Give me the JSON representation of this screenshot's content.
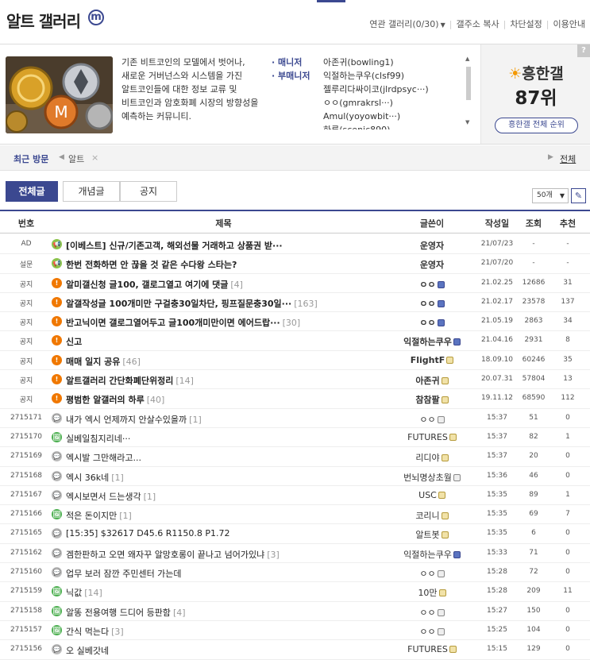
{
  "gallery": {
    "title": "알트 갤러리",
    "badge": "m"
  },
  "header": {
    "related": "연관 갤러리(0/30)",
    "copy_url": "갤주소 복사",
    "block_settings": "차단설정",
    "guide": "이용안내"
  },
  "info": {
    "description": "기존 비트코인의 모델에서 벗어나, 새로운 거버넌스와 시스템을 가진 알트코인들에 대한 정보 교류 및 비트코인과 암호화폐 시장의 방향성을 예측하는 커뮤니티.",
    "manager_label": "· 매니저",
    "manager": "아존귀(bowling1)",
    "submanager_label": "· 부매니저",
    "submanagers": [
      "익절하는쿠우(clsf99)",
      "젤루리다싸이코(jlrdpsyc···)",
      "ㅇㅇ(gmrakrsl···)",
      "Amul(yoyowbit···)",
      "하루(scenic890)"
    ]
  },
  "rank": {
    "q": "?",
    "sun": "☀",
    "name": "흥한갤",
    "number": "87위",
    "button": "흥한갤 전체 순위"
  },
  "recent": {
    "label": "최근 방문",
    "prev": "◀",
    "item": "알트",
    "close": "×",
    "next": "▶",
    "all": "전체"
  },
  "tabs": [
    {
      "label": "전체글"
    },
    {
      "label": "개념글"
    },
    {
      "label": "공지"
    }
  ],
  "page_size": "50개",
  "write_icon": "✎",
  "columns": {
    "no": "번호",
    "title": "제목",
    "writer": "글쓴이",
    "date": "작성일",
    "views": "조회",
    "recommend": "추천"
  },
  "icons": {
    "ad": "📢",
    "notice": "!",
    "chat": "💬",
    "image": "🖼"
  },
  "posts": [
    {
      "no": "AD",
      "icon": "ad",
      "title": "[이베스트] 신규/기존고객, 해외선물 거래하고 상품권 받···",
      "count": "",
      "writer": "운영자",
      "wicon": "",
      "date": "21/07/23",
      "views": "-",
      "rec": "-",
      "bold": true
    },
    {
      "no": "설문",
      "icon": "ad",
      "title": "한번 전화하면 안 끊을 것 같은 수다왕 스타는?",
      "count": "",
      "writer": "운영자",
      "wicon": "",
      "date": "21/07/20",
      "views": "-",
      "rec": "-",
      "bold": true
    },
    {
      "no": "공지",
      "icon": "notice",
      "title": "알미갤신청 글100, 갤로그열고 여기에 댓글",
      "count": "[4]",
      "writer": "ㅇㅇ",
      "wicon": "blue",
      "date": "21.02.25",
      "views": "12686",
      "rec": "31",
      "bold": true
    },
    {
      "no": "공지",
      "icon": "notice",
      "title": "알갤작성글 100개미만 구걸충30일차단, 핑프질문충30일···",
      "count": "[163]",
      "writer": "ㅇㅇ",
      "wicon": "blue",
      "date": "21.02.17",
      "views": "23578",
      "rec": "137",
      "bold": true
    },
    {
      "no": "공지",
      "icon": "notice",
      "title": "반고닉이면 갤로그열어두고 글100개미만이면 에어드랍···",
      "count": "[30]",
      "writer": "ㅇㅇ",
      "wicon": "blue",
      "date": "21.05.19",
      "views": "2863",
      "rec": "34",
      "bold": true
    },
    {
      "no": "공지",
      "icon": "notice",
      "title": "신고",
      "count": "",
      "writer": "익절하는쿠우",
      "wicon": "blue",
      "date": "21.04.16",
      "views": "2931",
      "rec": "8",
      "bold": true
    },
    {
      "no": "공지",
      "icon": "notice",
      "title": "매매 일지 공유",
      "count": "[46]",
      "writer": "FlightF",
      "wicon": "gold",
      "date": "18.09.10",
      "views": "60246",
      "rec": "35",
      "bold": true
    },
    {
      "no": "공지",
      "icon": "notice",
      "title": "알트갤러리 간단화폐단위정리",
      "count": "[14]",
      "writer": "아존귀",
      "wicon": "gold",
      "date": "20.07.31",
      "views": "57804",
      "rec": "13",
      "bold": true
    },
    {
      "no": "공지",
      "icon": "notice",
      "title": "평범한 알갤러의 하루",
      "count": "[40]",
      "writer": "참참팔",
      "wicon": "gold",
      "date": "19.11.12",
      "views": "68590",
      "rec": "112",
      "bold": true
    },
    {
      "no": "2715171",
      "icon": "chat",
      "title": "내가 엑시 언제까지 안살수있을까",
      "count": "[1]",
      "writer": "ㅇㅇ",
      "wicon": "grey",
      "date": "15:37",
      "views": "51",
      "rec": "0",
      "bold": false
    },
    {
      "no": "2715170",
      "icon": "img",
      "title": "실베일침지리네···",
      "count": "",
      "writer": "FUTURES",
      "wicon": "gold",
      "date": "15:37",
      "views": "82",
      "rec": "1",
      "bold": false
    },
    {
      "no": "2715169",
      "icon": "chat",
      "title": "엑시발 그만해라고...",
      "count": "",
      "writer": "리디야",
      "wicon": "gold",
      "date": "15:37",
      "views": "20",
      "rec": "0",
      "bold": false
    },
    {
      "no": "2715168",
      "icon": "chat",
      "title": "엑시 36k네",
      "count": "[1]",
      "writer": "번뇌명상초월",
      "wicon": "grey",
      "date": "15:36",
      "views": "46",
      "rec": "0",
      "bold": false
    },
    {
      "no": "2715167",
      "icon": "chat",
      "title": "엑시보면서 드는생각",
      "count": "[1]",
      "writer": "USC",
      "wicon": "gold",
      "date": "15:35",
      "views": "89",
      "rec": "1",
      "bold": false
    },
    {
      "no": "2715166",
      "icon": "img",
      "title": "적은 돈이지만",
      "count": "[1]",
      "writer": "코리니",
      "wicon": "gold",
      "date": "15:35",
      "views": "69",
      "rec": "7",
      "bold": false
    },
    {
      "no": "2715165",
      "icon": "chat",
      "title": "[15:35] $32617 D45.6 R1150.8 P1.72",
      "count": "",
      "writer": "알트봇",
      "wicon": "gold",
      "date": "15:35",
      "views": "6",
      "rec": "0",
      "bold": false
    },
    {
      "no": "2715162",
      "icon": "chat",
      "title": "겜한판하고 오면 왜자꾸 알망호롱이 끝나고 넘어가있냐",
      "count": "[3]",
      "writer": "익절하는쿠우",
      "wicon": "blue",
      "date": "15:33",
      "views": "71",
      "rec": "0",
      "bold": false
    },
    {
      "no": "2715160",
      "icon": "chat",
      "title": "업무 보러 잠깐 주민센터 가는데",
      "count": "",
      "writer": "ㅇㅇ",
      "wicon": "grey",
      "date": "15:28",
      "views": "72",
      "rec": "0",
      "bold": false
    },
    {
      "no": "2715159",
      "icon": "img",
      "title": "닉값",
      "count": "[14]",
      "writer": "10만",
      "wicon": "gold",
      "date": "15:28",
      "views": "209",
      "rec": "11",
      "bold": false
    },
    {
      "no": "2715158",
      "icon": "img",
      "title": "알똥 전용여행 드디어 등판함",
      "count": "[4]",
      "writer": "ㅇㅇ",
      "wicon": "grey",
      "date": "15:27",
      "views": "150",
      "rec": "0",
      "bold": false
    },
    {
      "no": "2715157",
      "icon": "img",
      "title": "간식 먹는다",
      "count": "[3]",
      "writer": "ㅇㅇ",
      "wicon": "grey",
      "date": "15:25",
      "views": "104",
      "rec": "0",
      "bold": false
    },
    {
      "no": "2715156",
      "icon": "chat",
      "title": "오 실베갓네",
      "count": "",
      "writer": "FUTURES",
      "wicon": "gold",
      "date": "15:15",
      "views": "129",
      "rec": "0",
      "bold": false
    }
  ]
}
